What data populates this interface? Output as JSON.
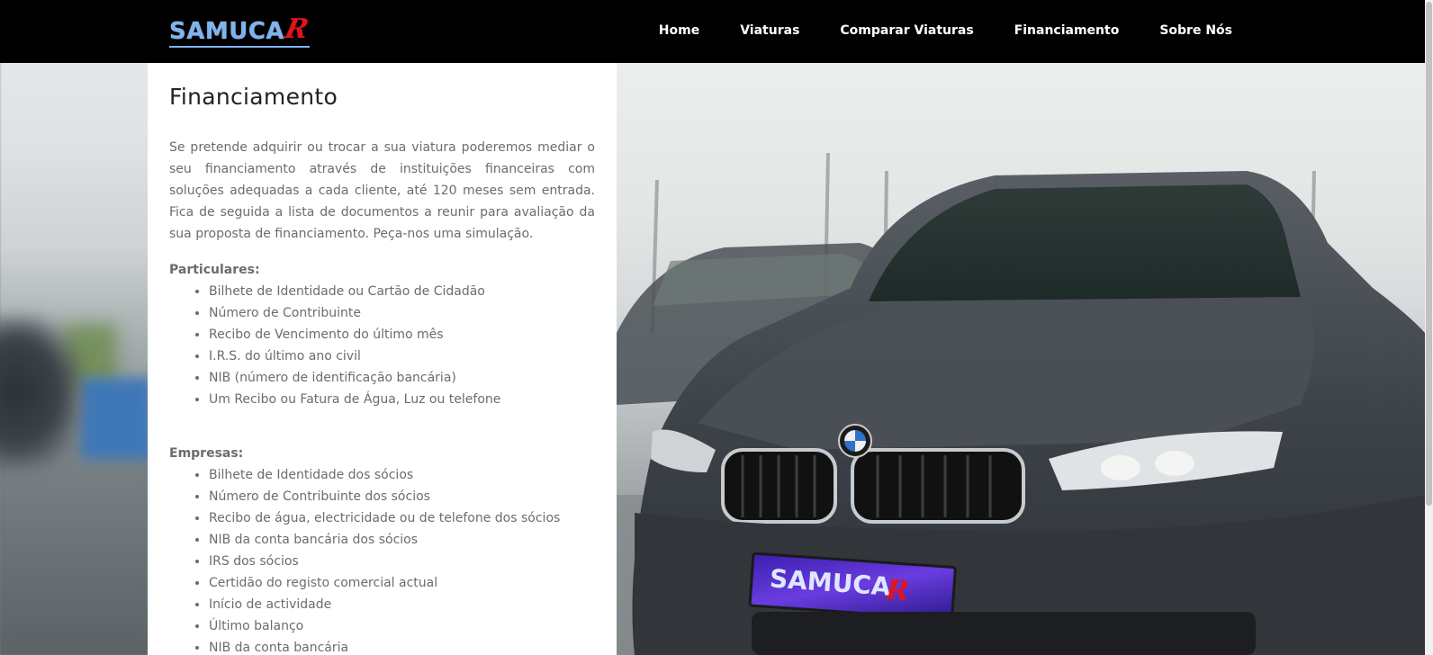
{
  "brand": {
    "logo_main": "SAMUCA",
    "logo_r": "R"
  },
  "nav": {
    "items": [
      {
        "label": "Home"
      },
      {
        "label": "Viaturas"
      },
      {
        "label": "Comparar Viaturas"
      },
      {
        "label": "Financiamento"
      },
      {
        "label": "Sobre Nós"
      }
    ]
  },
  "content": {
    "title": "Financiamento",
    "intro": "Se pretende adquirir ou trocar a sua viatura poderemos mediar o seu financiamento através de instituições financeiras com soluções adequadas a cada cliente, até 120 meses sem entrada. Fica de seguida a lista de documentos a reunir para avaliação da sua proposta de financiamento. Peça-nos uma simulação.",
    "particulares": {
      "label": "Particulares:",
      "items": [
        "Bilhete de Identidade ou Cartão de Cidadão",
        "Número de Contribuinte",
        "Recibo de Vencimento do último mês",
        "I.R.S. do último ano civil",
        "NIB (número de identificação bancária)",
        "Um Recibo ou Fatura de Água, Luz ou telefone"
      ]
    },
    "empresas": {
      "label": "Empresas:",
      "items": [
        "Bilhete de Identidade dos sócios",
        "Número de Contribuinte dos sócios",
        "Recibo de água, electricidade ou de telefone dos sócios",
        "NIB da conta bancária dos sócios",
        "IRS dos sócios",
        "Certidão do registo comercial actual",
        "Início de actividade",
        "Último balanço",
        "NIB da conta bancária"
      ]
    }
  },
  "photo": {
    "plate_text": "SAMUCA",
    "plate_r": "R"
  },
  "colors": {
    "header_bg": "#000000",
    "nav_text": "#ffffff",
    "body_text": "#6c6c6c",
    "logo_blue": "#7fb3ee",
    "logo_red": "#e0141a"
  }
}
